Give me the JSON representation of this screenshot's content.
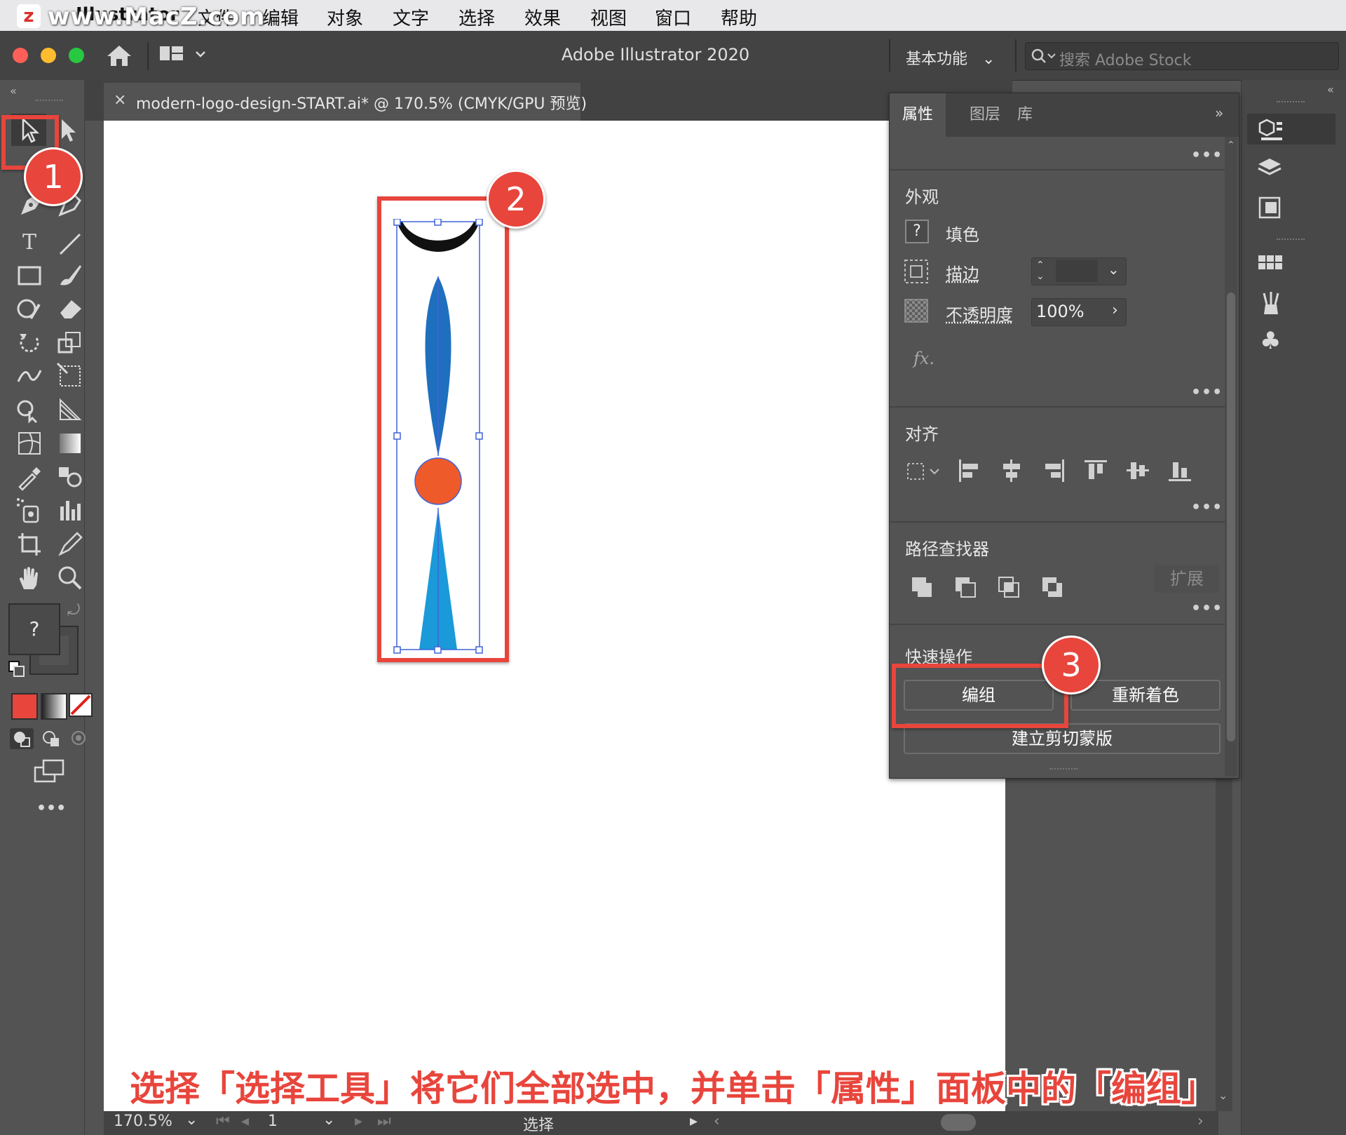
{
  "menubar": {
    "watermark": "www.MacZ.com",
    "app_name": "Illustrator",
    "items": [
      "文件",
      "编辑",
      "对象",
      "文字",
      "选择",
      "效果",
      "视图",
      "窗口",
      "帮助"
    ]
  },
  "appbar": {
    "title": "Adobe Illustrator 2020",
    "workspace": "基本功能",
    "search_placeholder": "搜索 Adobe Stock"
  },
  "document": {
    "tab_label": "modern-logo-design-START.ai* @ 170.5% (CMYK/GPU 预览)",
    "close_glyph": "×"
  },
  "tools": {
    "type_glyph": "T",
    "fill_unknown": "?",
    "more": "•••"
  },
  "statusbar": {
    "zoom": "170.5%",
    "artboard": "1",
    "tool_name": "选择"
  },
  "properties": {
    "tabs": [
      "属性",
      "图层",
      "库"
    ],
    "appearance": {
      "title": "外观",
      "fill_label": "填色",
      "fill_value": "?",
      "stroke_label": "描边",
      "opacity_label": "不透明度",
      "opacity_value": "100%",
      "fx": "fx."
    },
    "align": {
      "title": "对齐"
    },
    "pathfinder": {
      "title": "路径查找器",
      "expand": "扩展"
    },
    "quick_actions": {
      "title": "快速操作",
      "group": "编组",
      "recolor": "重新着色",
      "clip_mask": "建立剪切蒙版"
    }
  },
  "annotations": {
    "badge1": "1",
    "badge2": "2",
    "badge3": "3",
    "caption": "选择「选择工具」将它们全部选中，并单击「属性」面板中的「编组」"
  },
  "colors": {
    "accent": "#e8453c",
    "logo_blue_dark": "#1f6fbf",
    "logo_blue_light": "#1a9ad9",
    "logo_orange": "#ef5a2b",
    "selection": "#3f63d9"
  }
}
